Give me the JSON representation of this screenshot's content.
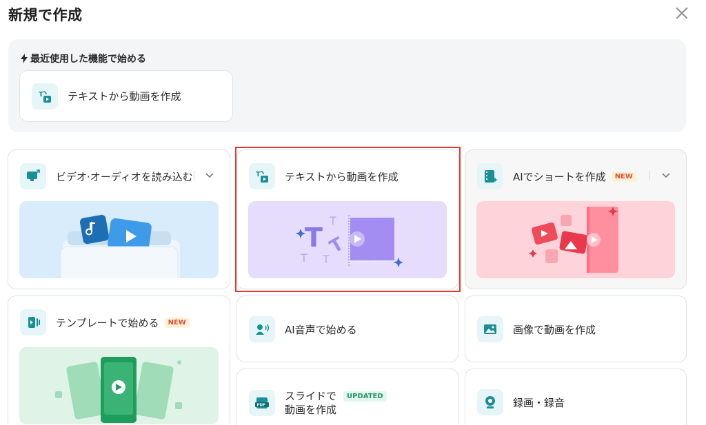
{
  "dialog": {
    "title": "新規で作成"
  },
  "recent": {
    "heading": "最近使用した機能で始める",
    "items": [
      {
        "label": "テキストから動画を作成"
      }
    ]
  },
  "cards": {
    "import": {
      "label": "ビデオ·オーディオを読み込む"
    },
    "text_to_video": {
      "label": "テキストから動画を作成"
    },
    "ai_short": {
      "label": "AIでショートを作成",
      "badge": "NEW"
    },
    "template": {
      "label": "テンプレートで始める",
      "badge": "NEW"
    },
    "ai_voice": {
      "label": "AI音声で始める"
    },
    "image_to_video": {
      "label": "画像で動画を作成"
    },
    "slides": {
      "label_line1": "スライドで",
      "label_line2": "動画を作成",
      "badge": "UPDATED"
    },
    "record": {
      "label": "録画・録音"
    }
  },
  "icons": {
    "close": "close-icon",
    "bolt": "lightning-icon",
    "text_to_video": "text-to-video-icon",
    "import": "import-media-icon",
    "ai_short": "film-sparkle-icon",
    "template": "template-icon",
    "ai_voice": "voice-icon",
    "image": "image-icon",
    "slides": "pdf-slides-icon",
    "record": "webcam-icon",
    "dropdown": "chevron-down-icon",
    "letter_t": "T",
    "pdf_text": "PDF"
  },
  "colors": {
    "accent": "#1a8f98",
    "icon_bg": "#e6f6f8",
    "highlight_border": "#e23a2c",
    "import_preview": "#d9ecfb",
    "text_preview": "#e6dcfb",
    "short_preview": "#ffd3da",
    "template_preview": "#dff4e7"
  }
}
